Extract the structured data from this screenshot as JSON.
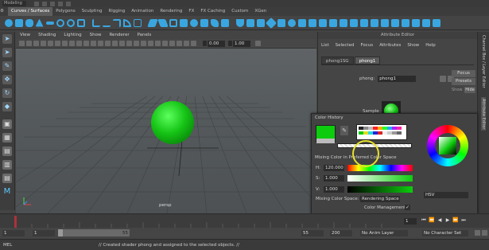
{
  "top_bar": {
    "workspace": "Modeling"
  },
  "shelf_tabs": [
    {
      "label": "Curves / Surfaces",
      "active": true
    },
    {
      "label": "Polygons",
      "active": false
    },
    {
      "label": "Sculpting",
      "active": false
    },
    {
      "label": "Rigging",
      "active": false
    },
    {
      "label": "Animation",
      "active": false
    },
    {
      "label": "Rendering",
      "active": false
    },
    {
      "label": "FX",
      "active": false
    },
    {
      "label": "FX Caching",
      "active": false
    },
    {
      "label": "Custom",
      "active": false
    },
    {
      "label": "XGen",
      "active": false
    }
  ],
  "viewport": {
    "menu": [
      "View",
      "Shading",
      "Lighting",
      "Show",
      "Renderer",
      "Panels"
    ],
    "toolbar_value_1": "0.00",
    "toolbar_value_2": "1.00",
    "camera_label": "persp"
  },
  "attribute_editor": {
    "title": "Attribute Editor",
    "menu": [
      "List",
      "Selected",
      "Focus",
      "Attributes",
      "Show",
      "Help"
    ],
    "tabs": [
      {
        "label": "phong1SG",
        "active": false
      },
      {
        "label": "phong1",
        "active": true
      }
    ],
    "node_label": "phong:",
    "node_value": "phong1",
    "focus_label": "Focus",
    "presets_label": "Presets",
    "show_label": "Show",
    "hide_label": "Hide",
    "sample_label": "Sample"
  },
  "right_strip": {
    "channel_box_label": "Channel Box / Layer Editor",
    "attribute_editor_label": "Attribute Editor"
  },
  "color_chooser": {
    "history_label": "Color History",
    "mixing_label": "Mixing Color in Preferred Color Space",
    "h_label": "H:",
    "h_value": "120.000",
    "s_label": "S:",
    "s_value": "1.000",
    "v_label": "V:",
    "v_value": "1.000",
    "space_label": "Mixing Color Space:",
    "space_value": "Rendering Space",
    "mode_value": "HSV",
    "color_management_label": "Color Management",
    "current_color": "#0dcc0d"
  },
  "timeline": {
    "start_value": "1",
    "current_value": "1",
    "range_start": "1",
    "range_end": "55",
    "end_value_1": "55",
    "end_value_2": "200",
    "anim_layer": "No Anim Layer",
    "character_set": "No Character Set"
  },
  "command_line": {
    "label": "MEL",
    "message": "// Created shader phong and assigned to the selected objects. //"
  }
}
